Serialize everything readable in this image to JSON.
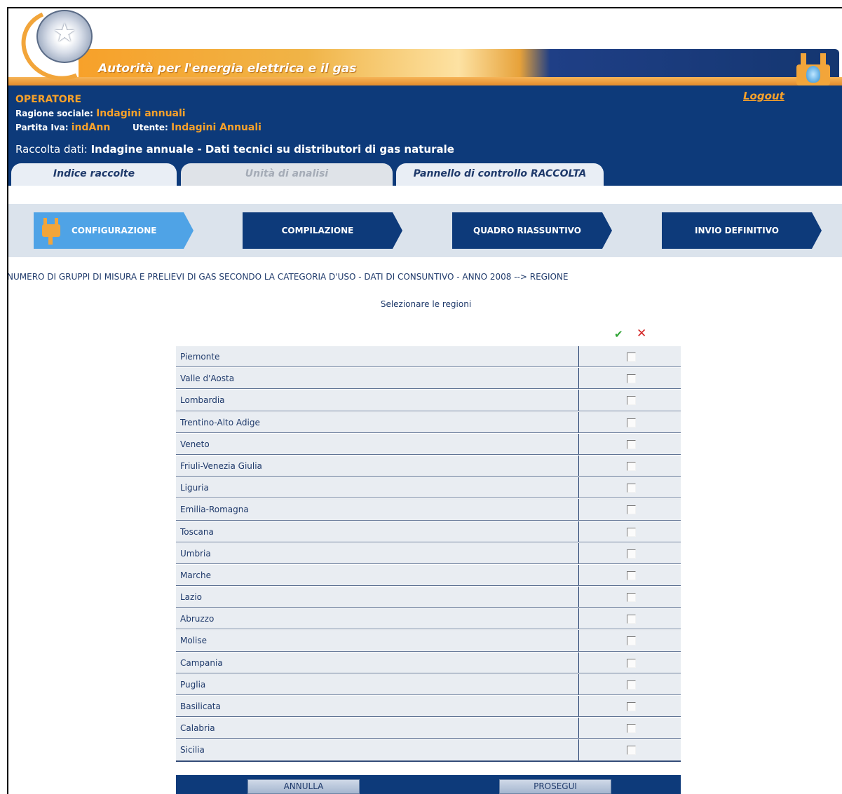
{
  "header": {
    "brand": "Autorità per l'energia elettrica e il gas",
    "emblem_icon": "italian-republic-emblem",
    "plug_icon": "plug-flame-icon"
  },
  "operator": {
    "title": "OPERATORE",
    "ragione_label": "Ragione sociale:",
    "ragione_value": "Indagini annuali",
    "piva_label": "Partita Iva:",
    "piva_value": "indAnn",
    "utente_label": "Utente:",
    "utente_value": "Indagini Annuali",
    "logout": "Logout",
    "raccolta_label": "Raccolta dati:",
    "raccolta_value": "Indagine annuale - Dati tecnici su distributori di gas naturale"
  },
  "tabs": [
    {
      "label": "Indice raccolte",
      "enabled": true
    },
    {
      "label": "Unità di analisi",
      "enabled": false
    },
    {
      "label": "Pannello di controllo RACCOLTA",
      "enabled": true
    }
  ],
  "steps": [
    {
      "label": "CONFIGURAZIONE",
      "active": true
    },
    {
      "label": "COMPILAZIONE",
      "active": false
    },
    {
      "label": "QUADRO RIASSUNTIVO",
      "active": false
    },
    {
      "label": "INVIO DEFINITIVO",
      "active": false
    }
  ],
  "breadcrumb": "NUMERO DI GRUPPI DI MISURA E PRELIEVI DI GAS SECONDO LA CATEGORIA D'USO - DATI DI CONSUNTIVO - ANNO 2008 --> REGIONE",
  "instruction": "Selezionare le regioni",
  "table": {
    "select_all_icon": "check-icon",
    "deselect_all_icon": "close-icon",
    "regions": [
      {
        "name": "Piemonte",
        "checked": false
      },
      {
        "name": "Valle d'Aosta",
        "checked": false
      },
      {
        "name": "Lombardia",
        "checked": false
      },
      {
        "name": "Trentino-Alto Adige",
        "checked": false
      },
      {
        "name": "Veneto",
        "checked": false
      },
      {
        "name": "Friuli-Venezia Giulia",
        "checked": false
      },
      {
        "name": "Liguria",
        "checked": false
      },
      {
        "name": "Emilia-Romagna",
        "checked": false
      },
      {
        "name": "Toscana",
        "checked": false
      },
      {
        "name": "Umbria",
        "checked": false
      },
      {
        "name": "Marche",
        "checked": false
      },
      {
        "name": "Lazio",
        "checked": false
      },
      {
        "name": "Abruzzo",
        "checked": false
      },
      {
        "name": "Molise",
        "checked": false
      },
      {
        "name": "Campania",
        "checked": false
      },
      {
        "name": "Puglia",
        "checked": false
      },
      {
        "name": "Basilicata",
        "checked": false
      },
      {
        "name": "Calabria",
        "checked": false
      },
      {
        "name": "Sicilia",
        "checked": false
      }
    ]
  },
  "buttons": {
    "annulla": "ANNULLA",
    "prosegui": "PROSEGUI"
  },
  "colors": {
    "navy": "#0d3a7a",
    "orange": "#f7a12a",
    "active_step": "#4fa3e6",
    "row_bg": "#e9edf2"
  }
}
